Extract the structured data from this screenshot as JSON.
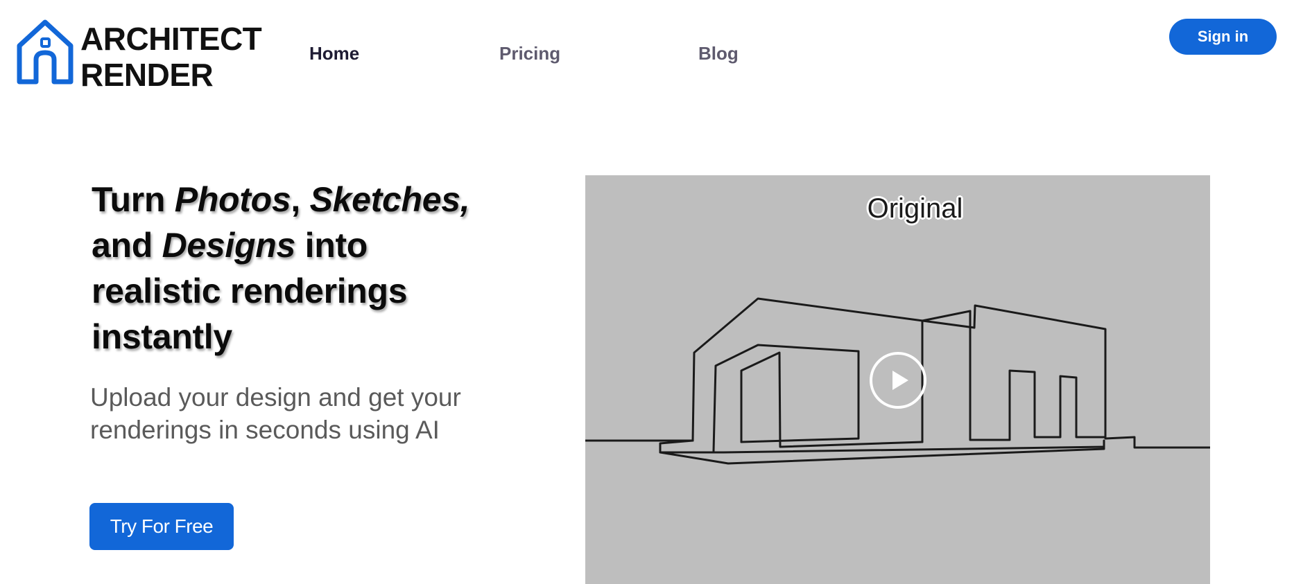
{
  "header": {
    "logo": {
      "line1": "ARCHITECT",
      "line2": "RENDER",
      "icon": "house-logo-icon",
      "color": "#1267d8"
    },
    "nav": [
      {
        "label": "Home",
        "active": true
      },
      {
        "label": "Pricing",
        "active": false
      },
      {
        "label": "Blog",
        "active": false
      }
    ],
    "signin_label": "Sign in"
  },
  "hero": {
    "title": {
      "part1": "Turn ",
      "photos": "Photos",
      "comma1": ", ",
      "sketches": "Sketches,",
      "line2_start": "and ",
      "designs": "Designs",
      "line2_end": " into",
      "line3": "realistic renderings",
      "line4": "instantly"
    },
    "subtitle": "Upload your design and get your renderings in seconds using AI",
    "cta_label": "Try For Free"
  },
  "video": {
    "label": "Original",
    "play_icon": "play-icon",
    "background": "#bebebe"
  },
  "colors": {
    "accent": "#1267d8",
    "nav_active": "#1e1b33",
    "nav_inactive": "#5e5a6e",
    "subtitle": "#5a5a5a"
  }
}
